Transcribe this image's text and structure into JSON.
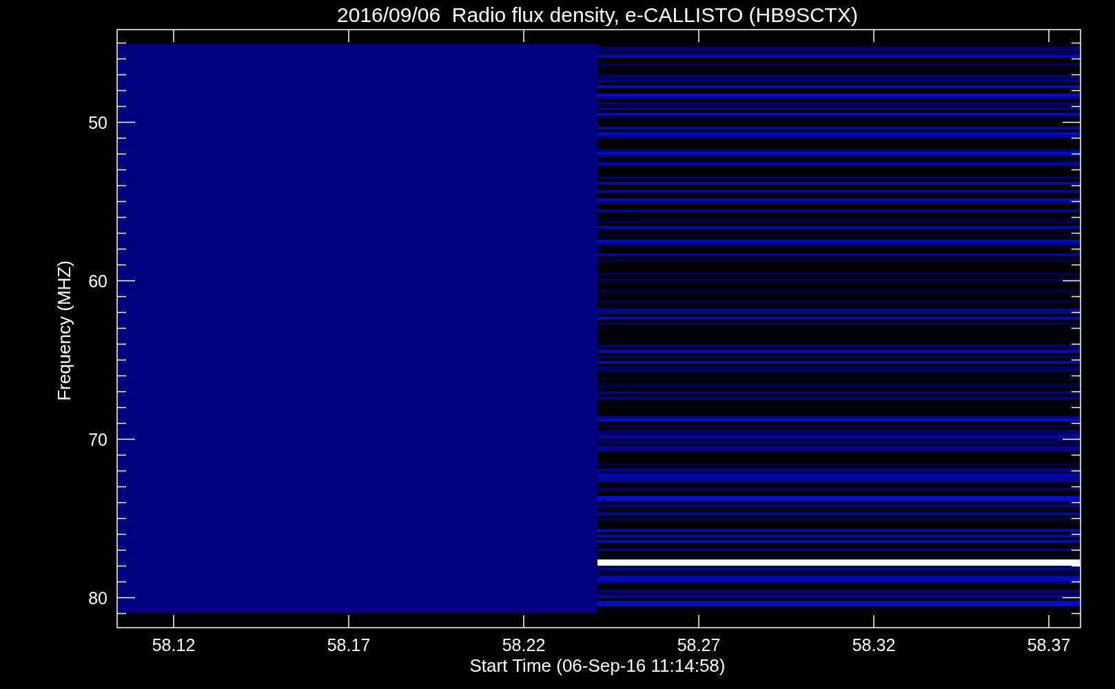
{
  "chart": {
    "title": "2016/09/06  Radio flux density, e-CALLISTO (HB9SCTX)",
    "xlabel": "Start Time (06-Sep-16 11:14:58)",
    "ylabel": "Frequency (MHZ)",
    "xtick_labels": [
      "58.12",
      "58.17",
      "58.22",
      "58.27",
      "58.32",
      "58.37"
    ],
    "ytick_labels": [
      "50",
      "60",
      "70",
      "80"
    ]
  }
}
